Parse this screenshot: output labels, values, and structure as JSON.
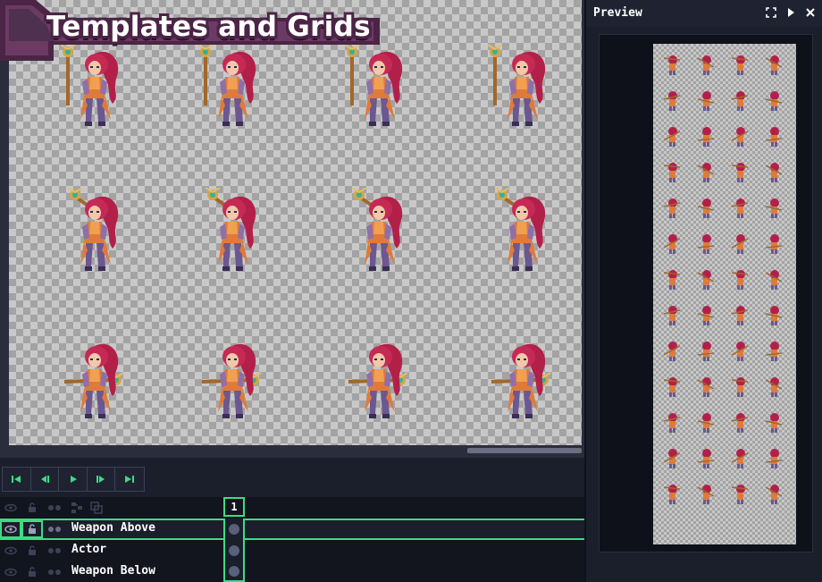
{
  "canvas": {
    "title": "Templates and Grids"
  },
  "playback": {
    "buttons": [
      {
        "icon": "skip-to-start-icon"
      },
      {
        "icon": "step-back-icon"
      },
      {
        "icon": "play-icon"
      },
      {
        "icon": "step-forward-icon"
      },
      {
        "icon": "skip-to-end-icon"
      }
    ]
  },
  "layers": {
    "frame_number": "1",
    "rows": [
      {
        "name": "Weapon Above",
        "selected": true
      },
      {
        "name": "Actor",
        "selected": false
      },
      {
        "name": "Weapon Below",
        "selected": false
      }
    ]
  },
  "preview": {
    "title": "Preview"
  },
  "colors": {
    "accent": "#3ddc84",
    "panel": "#1b1e2b",
    "banner": "#4b2446"
  }
}
